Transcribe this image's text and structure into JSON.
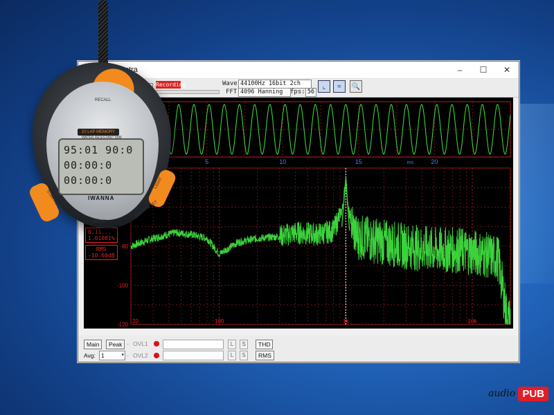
{
  "window": {
    "title": "Spectra",
    "controls": [
      "–",
      "☐",
      "✕"
    ]
  },
  "toolbar": {
    "recording_label": "Recording",
    "wave_label": "Wave:",
    "wave_value": "44100Hz 16bit 2ch",
    "fft_label": "FFT:",
    "fft_value": "4096 Hanning",
    "fps_label": "fps:",
    "fps_value": "56"
  },
  "readouts": {
    "thd_value_1": "0.11...",
    "thd_value_2": "1.01081%",
    "rms_label": "RMS",
    "rms_value": "-10.60dB"
  },
  "statusbar": {
    "main": "Main",
    "peak": "Peak",
    "ovl1": "OVL1",
    "ovl2": "OVL2",
    "avg_label": "Avg:",
    "avg_value": "1",
    "l": "L",
    "s": "S",
    "thd": "THD",
    "rms": "RMS",
    "dash": "-"
  },
  "stopwatch": {
    "line1": "95:01 90:0",
    "line2": "00:00:0",
    "line3": "00:00:0",
    "brand": "IWANNA",
    "labels": [
      "RECALL",
      "MODE",
      "SPLIT/RESET",
      "START/STOP",
      "LIGHT",
      "10 LAP MEMORY",
      "WATER RESISTANT 50M"
    ]
  },
  "logo": {
    "part1": "audio",
    "part2": "PUB"
  },
  "chart_data": [
    {
      "type": "line",
      "subtype": "waveform",
      "xlabel": "ms",
      "x_ticks": [
        5,
        10,
        15,
        20
      ],
      "xlim": [
        0,
        25
      ],
      "ylim": [
        -1,
        1
      ],
      "series": [
        {
          "signal": "sine",
          "frequency_hz": 1000
        }
      ],
      "color": "#3cd23c",
      "grid": true
    },
    {
      "type": "line",
      "subtype": "spectrum",
      "x_scale": "log",
      "x_ticks": [
        "20",
        "100",
        "1k",
        "10k"
      ],
      "xlim": [
        20,
        20000
      ],
      "y_ticks": [
        -60,
        -80,
        -100,
        -120
      ],
      "ylim": [
        -120,
        -40
      ],
      "peak_frequency_hz": 1000,
      "color": "#3cd23c",
      "grid": true,
      "series": [
        {
          "points": [
            [
              20,
              -80
            ],
            [
              30,
              -76
            ],
            [
              45,
              -73
            ],
            [
              60,
              -74
            ],
            [
              80,
              -76
            ],
            [
              100,
              -84
            ],
            [
              140,
              -78
            ],
            [
              200,
              -76
            ],
            [
              300,
              -75
            ],
            [
              400,
              -73
            ],
            [
              600,
              -74
            ],
            [
              800,
              -72
            ],
            [
              950,
              -60
            ],
            [
              1000,
              -45
            ],
            [
              1050,
              -62
            ],
            [
              1200,
              -75
            ],
            [
              2000,
              -78
            ],
            [
              3000,
              -80
            ],
            [
              5000,
              -82
            ],
            [
              8000,
              -82
            ],
            [
              12000,
              -84
            ],
            [
              16000,
              -86
            ],
            [
              19000,
              -118
            ]
          ]
        }
      ]
    }
  ]
}
